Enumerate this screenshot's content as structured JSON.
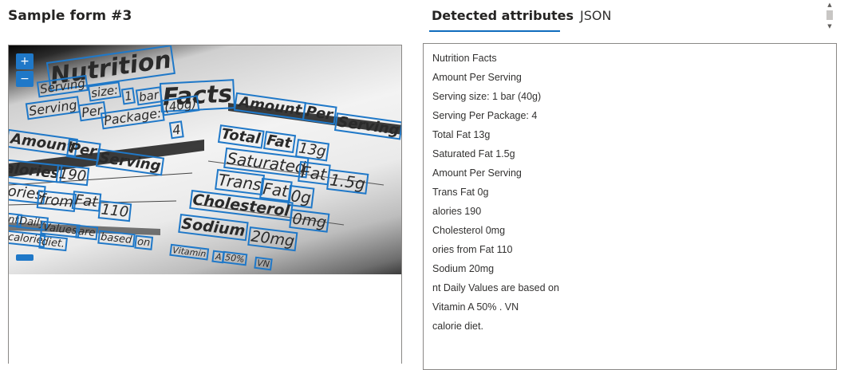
{
  "form_title": "Sample form #3",
  "tabs": [
    {
      "label": "Detected attributes",
      "active": true
    },
    {
      "label": "JSON",
      "active": false
    }
  ],
  "zoom": {
    "in_label": "+",
    "out_label": "−"
  },
  "scrollbar": {
    "up": "▲",
    "down": "▼"
  },
  "accent_color": "#0f6cbd",
  "box_color": "#1f78c8",
  "image_words": [
    "Nutrition",
    "Facts",
    "Serving",
    "size:",
    "1",
    "bar",
    "(40g)",
    "Serving",
    "Per",
    "Package:",
    "4",
    "Amount",
    "Per",
    "Serving",
    "Amount",
    "Per",
    "Serving",
    "alories",
    "190",
    "ories",
    "from",
    "Fat",
    "110",
    "nt",
    "Daily",
    "Values",
    "are",
    "based",
    "on",
    "calorie",
    "diet.",
    "Total",
    "Fat",
    "13g",
    "Saturated",
    "Fat",
    "1.5g",
    "Trans",
    "Fat",
    "0g",
    "Cholesterol",
    "0mg",
    "Sodium",
    "20mg",
    "Vitamin",
    "A",
    "50%",
    "VN"
  ],
  "attributes": [
    "Nutrition Facts",
    "Amount Per Serving",
    "Serving size: 1 bar (40g)",
    "Serving Per Package: 4",
    "Total Fat 13g",
    "Saturated Fat 1.5g",
    "Amount Per Serving",
    "Trans Fat 0g",
    "alories 190",
    "Cholesterol 0mg",
    "ories from Fat 110",
    "Sodium 20mg",
    "nt Daily Values are based on",
    "Vitamin A 50% . VN",
    "calorie diet."
  ]
}
